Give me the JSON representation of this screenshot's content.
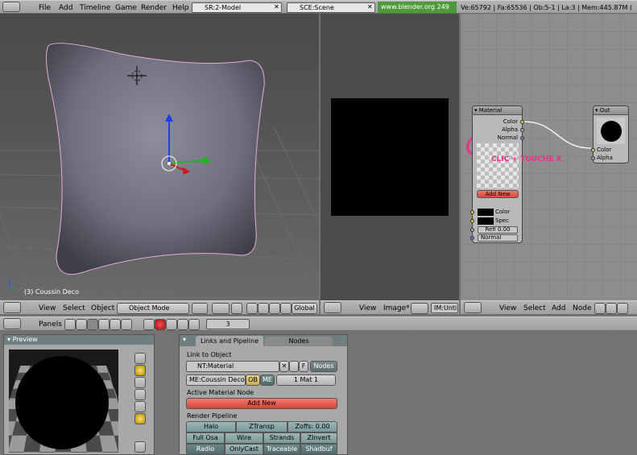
{
  "menubar": {
    "items": [
      "File",
      "Add",
      "Timeline",
      "Game",
      "Render",
      "Help"
    ],
    "screen": "SR:2-Model",
    "scene": "SCE:Scene",
    "url": "www.blender.org 249",
    "stats": "Ve:65792 | Fa:65536 | Ob:5-1 | La:3 | Mem:445.87M ("
  },
  "viewport": {
    "object_label": "(3) Coussin Deco",
    "header": {
      "view": "View",
      "select": "Select",
      "object": "Object",
      "mode": "Object Mode",
      "pivot_value": "3",
      "orient": "Global"
    }
  },
  "image_editor": {
    "header": {
      "view": "View",
      "image": "Image*",
      "im": "IM:Unti"
    }
  },
  "node_editor": {
    "material_node": {
      "title": "Material",
      "outputs": [
        "Color",
        "Alpha",
        "Normal"
      ],
      "add_new": "Add New",
      "inputs": [
        "Color",
        "Spec"
      ],
      "refl": "Refl 0.00",
      "normal": "Normal"
    },
    "output_node": {
      "title": "Out",
      "inputs": [
        "Color",
        "Alpha"
      ]
    },
    "annotation": "CLIC + TOUCHE X",
    "header": {
      "view": "View",
      "select": "Select",
      "add": "Add",
      "node": "Node"
    }
  },
  "buttons_header": {
    "panels": "Panels",
    "frame": "3"
  },
  "preview": {
    "title": "Preview"
  },
  "links_panel": {
    "tabs": [
      "Links and Pipeline",
      "Nodes"
    ],
    "link_to_object": "Link to Object",
    "nt_material": "NT:Material",
    "f_label": "F",
    "nodes_btn": "Nodes",
    "me_field": "ME:Coussin Deco",
    "ob": "OB",
    "me": "ME",
    "mat_count": "1 Mat 1",
    "active_material_node": "Active Material Node",
    "add_new": "Add New",
    "render_pipeline": "Render Pipeline",
    "pipeline": [
      [
        "Halo",
        "ZTransp",
        "Zoffs: 0.00"
      ],
      [
        "Full Osa",
        "Wire",
        "Strands",
        "ZInvert"
      ],
      [
        "Radio",
        "OnlyCast",
        "Traceable",
        "Shadbuf"
      ]
    ]
  },
  "colors": {
    "accent_red": "#e2544a",
    "node_bg": "#b9b9b9",
    "annotation_pink": "#e8338a"
  }
}
